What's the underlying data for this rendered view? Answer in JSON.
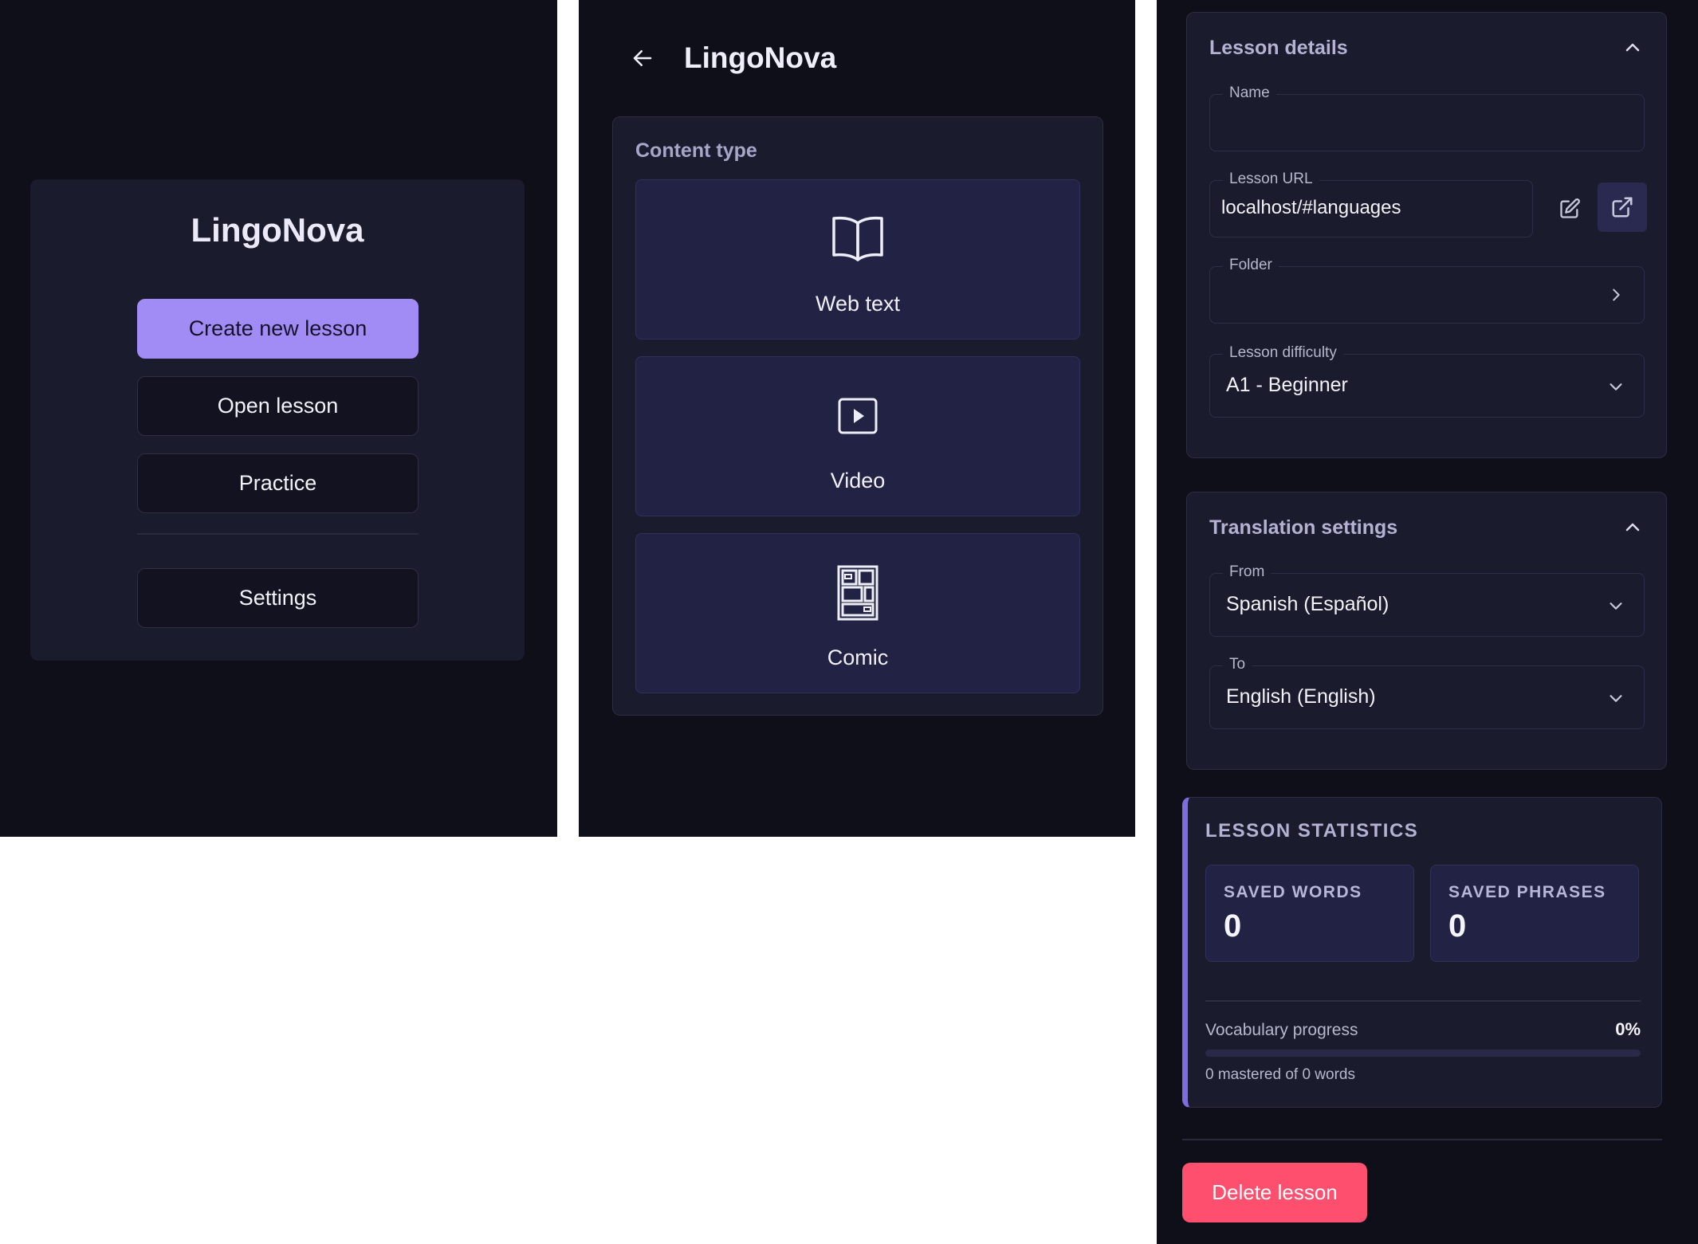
{
  "home": {
    "title": "LingoNova",
    "buttons": {
      "create": "Create new lesson",
      "open": "Open lesson",
      "practice": "Practice",
      "settings": "Settings"
    }
  },
  "content_type": {
    "header_title": "LingoNova",
    "section_label": "Content type",
    "options": [
      {
        "label": "Web text",
        "icon": "book-open-icon"
      },
      {
        "label": "Video",
        "icon": "video-play-icon"
      },
      {
        "label": "Comic",
        "icon": "comic-panels-icon"
      }
    ]
  },
  "lesson_details": {
    "title": "Lesson details",
    "name": {
      "label": "Name",
      "value": ""
    },
    "url": {
      "label": "Lesson URL",
      "value": "localhost/#languages"
    },
    "folder": {
      "label": "Folder",
      "value": ""
    },
    "difficulty": {
      "label": "Lesson difficulty",
      "value": "A1 - Beginner"
    }
  },
  "translation": {
    "title": "Translation settings",
    "from": {
      "label": "From",
      "value": "Spanish (Español)"
    },
    "to": {
      "label": "To",
      "value": "English (English)"
    }
  },
  "stats": {
    "title": "LESSON STATISTICS",
    "saved_words": {
      "label": "SAVED WORDS",
      "value": "0"
    },
    "saved_phrases": {
      "label": "SAVED PHRASES",
      "value": "0"
    },
    "vocab_label": "Vocabulary progress",
    "vocab_percent": "0%",
    "vocab_fraction": 0,
    "vocab_sub": "0 mastered of 0 words"
  },
  "delete_label": "Delete lesson",
  "colors": {
    "background": "#0f0f1a",
    "card": "#1b1b2e",
    "accent": "#a18cf6",
    "stats_accent": "#7c6de0",
    "danger": "#ff4f6e"
  }
}
